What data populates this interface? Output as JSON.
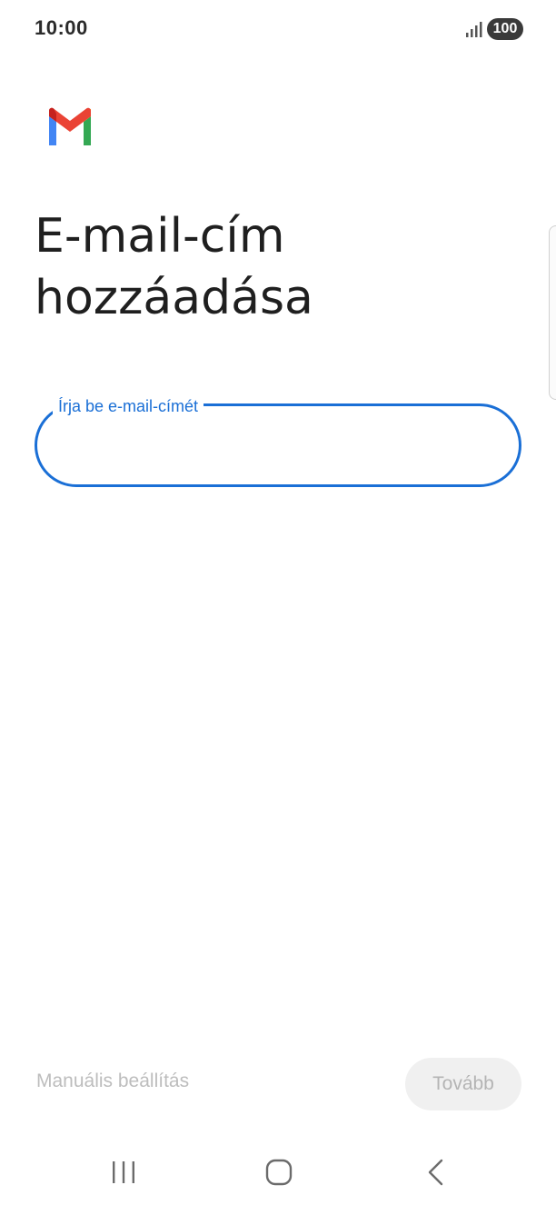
{
  "status_bar": {
    "time": "10:00",
    "battery": "100",
    "signal_icon": "signal-bars-icon"
  },
  "app": {
    "logo_icon": "gmail-logo-icon"
  },
  "main": {
    "title": "E-mail-cím hozzáadása",
    "email_field": {
      "label": "Írja be e-mail-címét",
      "value": ""
    }
  },
  "actions": {
    "manual_setup": "Manuális beállítás",
    "next": "Tovább"
  },
  "navigation": {
    "recents_icon": "recents-icon",
    "home_icon": "home-icon",
    "back_icon": "back-icon"
  },
  "colors": {
    "accent": "#1a6fd6",
    "title_text": "#1f1f1f",
    "disabled_text": "#bdbdbd",
    "disabled_button_bg": "#f0f0f0"
  }
}
